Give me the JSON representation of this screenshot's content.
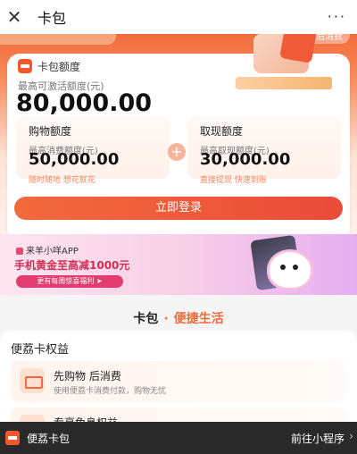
{
  "topbar": {
    "close_glyph": "✕",
    "title": "卡包",
    "more_glyph": "···"
  },
  "hero": {
    "banner_pill": "先购物后消费"
  },
  "card": {
    "label": "卡包额度",
    "max_label": "最高可激活额度(元)",
    "max_amount": "80,000.00",
    "shopping": {
      "title": "购物额度",
      "label": "最高消费额度(元)",
      "amount": "50,000.00",
      "note": "随时随地 想花就花"
    },
    "cash": {
      "title": "取现额度",
      "label": "最高取现额度(元)",
      "amount": "30,000.00",
      "note": "直接提现 快速到账"
    },
    "plus_glyph": "+"
  },
  "login_button": "立即登录",
  "promo": {
    "app_name": "来羊小咩APP",
    "headline": "手机黄金至高减1000元",
    "button": "更有每周惊喜福利 ➤"
  },
  "section": {
    "part_a": "卡包",
    "dot": "·",
    "part_b": "便捷生活"
  },
  "rights": {
    "title": "便荔卡权益",
    "items": [
      {
        "name": "先购物 后消费",
        "desc": "使用便荔卡消费付款，购物无忧"
      },
      {
        "name": "专享免息权益",
        "desc": ""
      }
    ]
  },
  "bottombar": {
    "name": "便荔卡包",
    "link": "前往小程序",
    "chevron": "›"
  },
  "colors": {
    "accent": "#f26a3c",
    "promo_accent": "#e23c70",
    "bar": "#2a2a2a"
  }
}
